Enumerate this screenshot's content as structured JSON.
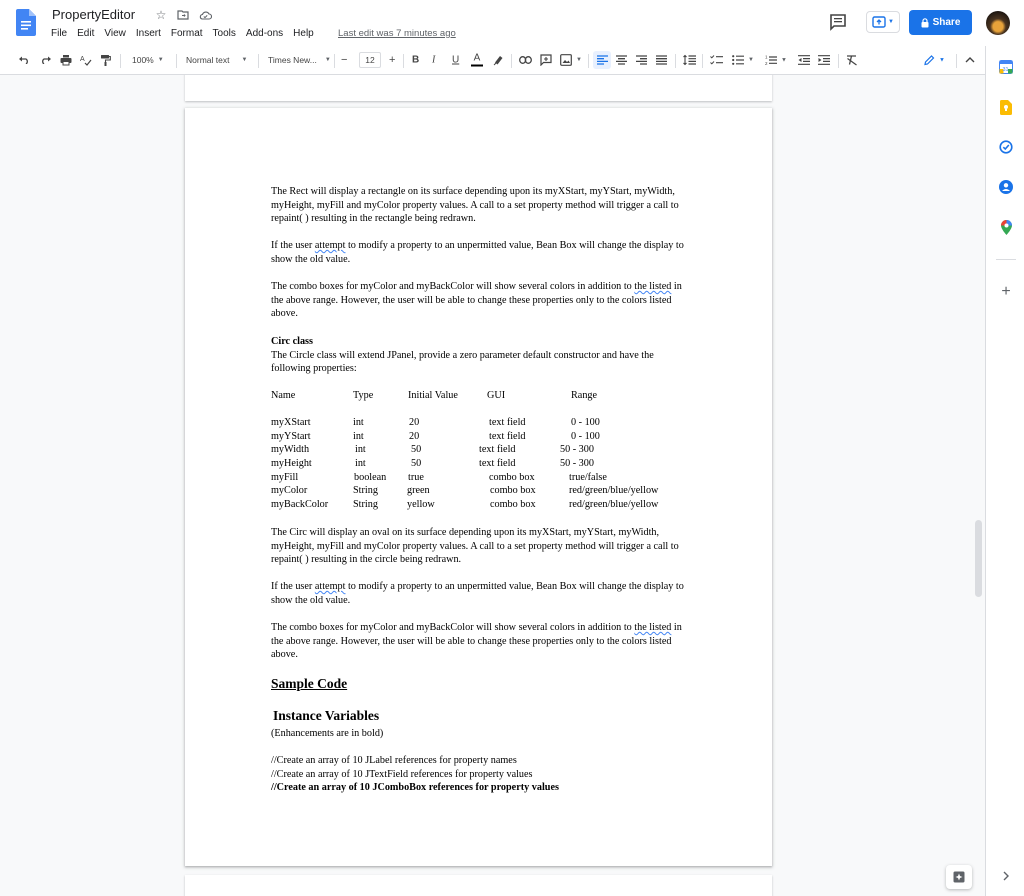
{
  "app": {
    "title": "PropertyEditor",
    "last_edit": "Last edit was 7 minutes ago",
    "share_label": "Share"
  },
  "menu": [
    "File",
    "Edit",
    "View",
    "Insert",
    "Format",
    "Tools",
    "Add-ons",
    "Help"
  ],
  "toolbar": {
    "zoom": "100%",
    "style": "Normal text",
    "font": "Times New...",
    "font_size": "12",
    "bold": "B",
    "italic": "I",
    "underline": "U",
    "text_color": "A"
  },
  "doc": {
    "rect_p1": "The Rect will display a rectangle on its surface depending upon its myXStart, myYStart, myWidth, myHeight, myFill and myColor property values. A call to a set property method will trigger a call to repaint( ) resulting in the rectangle being redrawn.",
    "rect_p2_a": "If the user ",
    "rect_p2_b": "attempt",
    "rect_p2_c": " to modify a property to an unpermitted value, Bean Box will change the display to show the old value.",
    "rect_p3_a": "The combo boxes for myColor and myBackColor will show several colors in addition to ",
    "rect_p3_b": "the listed",
    "rect_p3_c": " in the above range. However, the user will be able to change these properties only to the colors listed above.",
    "circ_heading": "Circ class",
    "circ_intro": "The Circle class will extend JPanel, provide a zero parameter default constructor and have the following properties:",
    "table_headers": [
      "Name",
      "Type",
      "Initial Value",
      "GUI",
      "Range"
    ],
    "table_rows": [
      [
        "myXStart",
        "int",
        "20",
        "text field",
        "0 - 100"
      ],
      [
        "myYStart",
        "int",
        "20",
        "text field",
        "0 - 100"
      ],
      [
        "myWidth",
        "int",
        "50",
        "text field",
        "50 - 300"
      ],
      [
        "myHeight",
        "int",
        "50",
        "text field",
        "50 - 300"
      ],
      [
        "myFill",
        "boolean",
        "true",
        "combo box",
        "true/false"
      ],
      [
        "myColor",
        "String",
        "green",
        "combo box",
        "red/green/blue/yellow"
      ],
      [
        "myBackColor",
        "String",
        "yellow",
        "combo box",
        "red/green/blue/yellow"
      ]
    ],
    "circ_p1": "The Circ will display an oval on its surface depending upon its myXStart, myYStart, myWidth, myHeight, myFill and myColor property values. A call to a set property method will trigger a call to repaint( ) resulting in the circle being redrawn.",
    "circ_p2_a": "If the user ",
    "circ_p2_b": "attempt",
    "circ_p2_c": " to modify a property to an unpermitted value, Bean Box will change the display to show the old value.",
    "circ_p3_a": "The combo boxes for myColor and myBackColor will show several colors in addition to ",
    "circ_p3_b": "the listed",
    "circ_p3_c": " in the above range. However, the user will be able to change these properties only to the colors listed above.",
    "sample_code": "Sample Code",
    "instance_vars": "Instance Variables",
    "enh_note": "(Enhancements are in bold)",
    "code1": "//Create an array of 10 JLabel references for property names",
    "code2": "//Create an array of 10 JTextField references for property values",
    "code3": "//Create an array of 10 JComboBox references for property values"
  },
  "colors": {
    "accent": "#1a73e8",
    "docs_blue": "#4285f4",
    "keep_yellow": "#fbbc04",
    "contacts_blue": "#1a73e8",
    "maps_red": "#ea4335"
  }
}
